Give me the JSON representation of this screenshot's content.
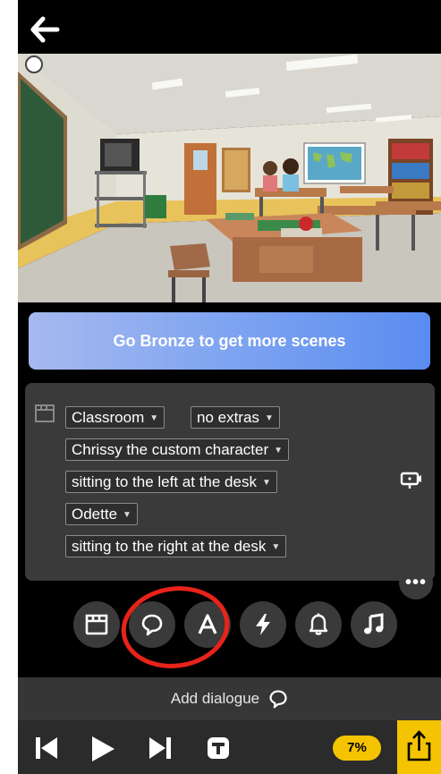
{
  "header": {
    "back_icon": "arrow-left-icon"
  },
  "banner": {
    "label": "Go Bronze to get more scenes"
  },
  "scene_settings": {
    "location": "Classroom",
    "extras": "no extras",
    "character1": "Chrissy the custom character",
    "character1_position": "sitting to the left at the desk",
    "character2": "Odette",
    "character2_position": "sitting to the right at the desk"
  },
  "toolbar": {
    "icons": [
      "clapperboard-icon",
      "speech-bubble-icon",
      "text-icon",
      "lightning-icon",
      "bell-icon",
      "music-note-icon"
    ],
    "more_label": "•••"
  },
  "dialogue_bar": {
    "label": "Add dialogue"
  },
  "playback": {
    "progress": "7%",
    "progress_value": 0.07
  },
  "colors": {
    "accent_yellow": "#f5c400",
    "banner_start": "#a6b9ef",
    "banner_end": "#5a8cf0",
    "panel_bg": "#3a3a3a",
    "annotation_red": "#e8231a"
  }
}
